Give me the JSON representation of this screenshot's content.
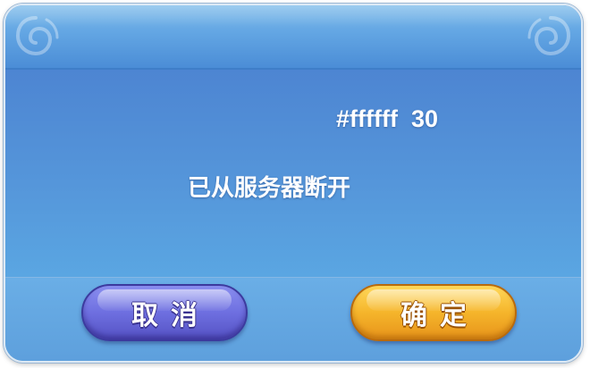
{
  "dialog": {
    "debug_text": "#ffffff  30",
    "message": "已从服务器断开"
  },
  "buttons": {
    "cancel_label": "取消",
    "confirm_label": "确定"
  },
  "colors": {
    "panel_blue": "#4f8bd5",
    "cancel_purple": "#6e6fe0",
    "confirm_gold": "#f5b52b",
    "text": "#ffffff"
  },
  "icons": {
    "corner_ornament": "cloud-swirl-icon"
  }
}
